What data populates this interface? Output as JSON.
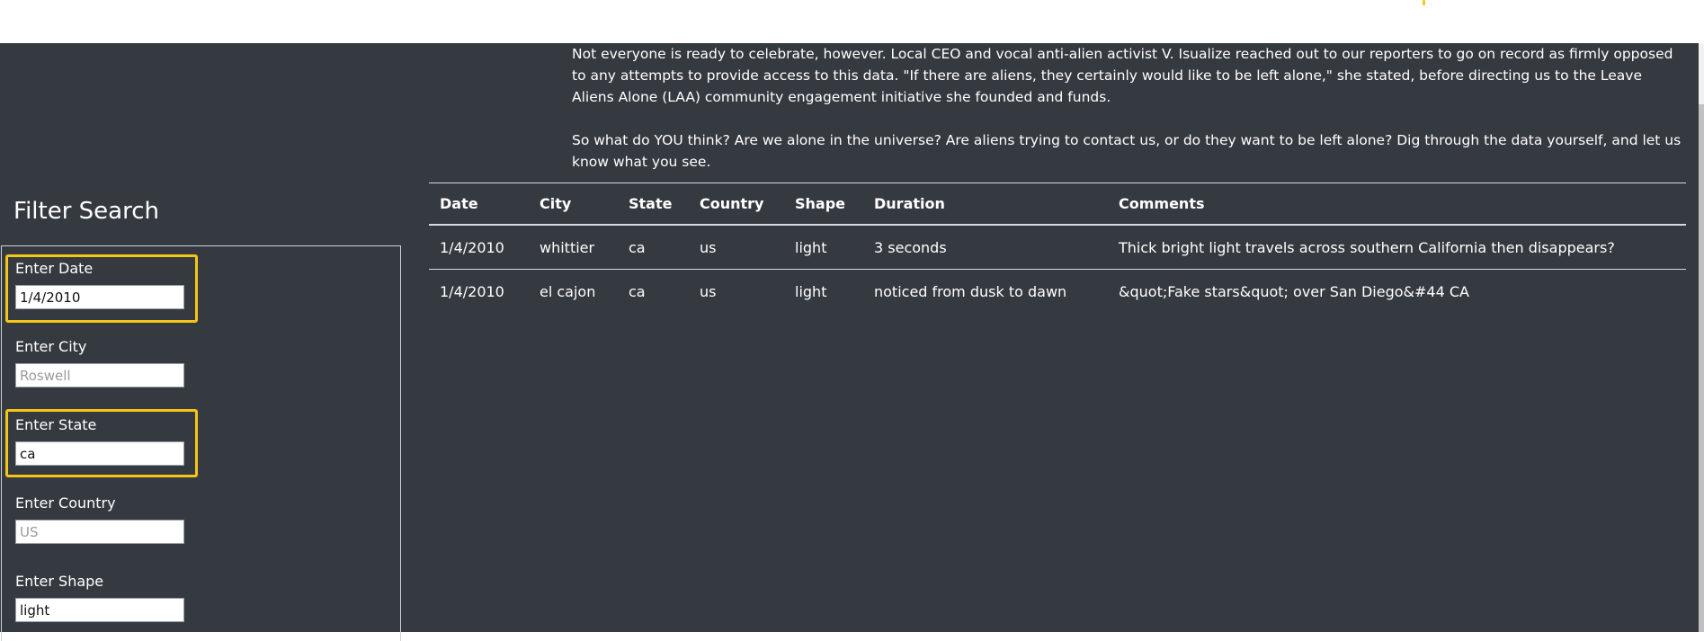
{
  "article": {
    "paragraph_1": "Not everyone is ready to celebrate, however. Local CEO and vocal anti-alien activist V. Isualize reached out to our reporters to go on record as firmly opposed to any attempts to provide access to this data. \"If there are aliens, they certainly would like to be left alone,\" she stated, before directing us to the Leave Aliens Alone (LAA) community engagement initiative she founded and funds.",
    "paragraph_2": "So what do YOU think? Are we alone in the universe? Are aliens trying to contact us, or do they want to be left alone? Dig through the data yourself, and let us know what you see."
  },
  "filters": {
    "title": "Filter Search",
    "date": {
      "label": "Enter Date",
      "value": "1/4/2010",
      "placeholder": ""
    },
    "city": {
      "label": "Enter City",
      "value": "",
      "placeholder": "Roswell"
    },
    "state": {
      "label": "Enter State",
      "value": "ca",
      "placeholder": ""
    },
    "country": {
      "label": "Enter Country",
      "value": "",
      "placeholder": "US"
    },
    "shape": {
      "label": "Enter Shape",
      "value": "light",
      "placeholder": ""
    }
  },
  "table": {
    "headers": [
      "Date",
      "City",
      "State",
      "Country",
      "Shape",
      "Duration",
      "Comments"
    ],
    "rows": [
      [
        "1/4/2010",
        "whittier",
        "ca",
        "us",
        "light",
        "3 seconds",
        "Thick bright light travels across southern California then disappears?"
      ],
      [
        "1/4/2010",
        "el cajon",
        "ca",
        "us",
        "light",
        "noticed from dusk to dawn",
        "&quot;Fake stars&quot; over San Diego&#44 CA"
      ]
    ]
  },
  "colors": {
    "background": "#353a40",
    "highlight": "#f5c518"
  }
}
